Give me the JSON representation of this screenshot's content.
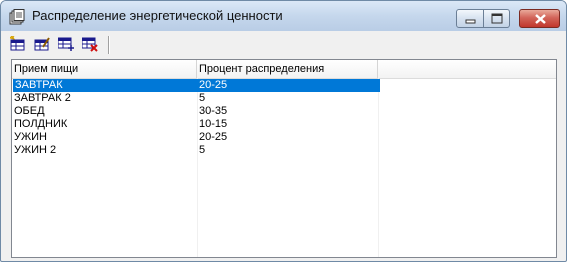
{
  "window": {
    "title": "Распределение энергетической ценности",
    "icon": "window-app-icon"
  },
  "titlebar_buttons": [
    "minimize-icon",
    "maximize-icon",
    "close-icon"
  ],
  "toolbar": {
    "buttons": [
      {
        "name": "add-record-button",
        "icon": "table-add-icon"
      },
      {
        "name": "edit-record-button",
        "icon": "table-edit-icon"
      },
      {
        "name": "insert-record-button",
        "icon": "table-insert-icon"
      },
      {
        "name": "delete-record-button",
        "icon": "table-delete-icon"
      }
    ]
  },
  "table": {
    "columns": [
      "Прием пищи",
      "Процент распределения",
      ""
    ],
    "rows": [
      {
        "meal": "ЗАВТРАК",
        "percent": "20-25",
        "selected": true
      },
      {
        "meal": "ЗАВТРАК 2",
        "percent": "5",
        "selected": false
      },
      {
        "meal": "ОБЕД",
        "percent": "30-35",
        "selected": false
      },
      {
        "meal": "ПОЛДНИК",
        "percent": "10-15",
        "selected": false
      },
      {
        "meal": "УЖИН",
        "percent": "20-25",
        "selected": false
      },
      {
        "meal": "УЖИН 2",
        "percent": "5",
        "selected": false
      }
    ]
  },
  "colors": {
    "selection": "#0078d7",
    "close_button": "#c1372d"
  }
}
